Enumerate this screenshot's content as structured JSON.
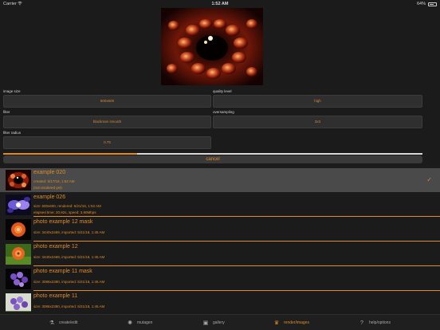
{
  "status": {
    "carrier": "Carrier",
    "time": "1:52 AM",
    "battery": "64%"
  },
  "settings": {
    "image_size": {
      "label": "image size",
      "value": "600x600"
    },
    "quality_level": {
      "label": "quality level",
      "value": "high"
    },
    "filter": {
      "label": "filter",
      "value": "blackman smooth"
    },
    "oversampling": {
      "label": "oversampling",
      "value": "3x3"
    },
    "filter_radius": {
      "label": "filter radius",
      "value": "0.75"
    }
  },
  "render": {
    "progress": 0.32,
    "cancel_label": "cancel"
  },
  "items": [
    {
      "title": "example 020",
      "line1": "created: 5/17/18, 1:52 AM",
      "line2": "(not rendered yet)",
      "selected": true
    },
    {
      "title": "example 026",
      "line1": "size: 600x600, rendered: 5/21/18, 1:52 AM",
      "line2": "elapsed time: 20.82s, speed: 3.80Mbps"
    },
    {
      "title": "photo example 12 mask",
      "line1": "size: 3440x2469, imported: 5/21/18, 1:45 AM"
    },
    {
      "title": "photo example 12",
      "line1": "size: 3440x2469, imported: 5/21/18, 1:45 AM"
    },
    {
      "title": "photo example 11 mask",
      "line1": "size: 3086x2380, imported: 5/21/18, 1:45 AM"
    },
    {
      "title": "photo example 11",
      "line1": "size: 3086x2380, imported: 5/21/18, 1:45 AM"
    }
  ],
  "tabs": [
    {
      "label": "create/edit",
      "icon": "flask-icon"
    },
    {
      "label": "mutagen",
      "icon": "mutagen-icon"
    },
    {
      "label": "gallery",
      "icon": "gallery-icon"
    },
    {
      "label": "render/images",
      "icon": "render-icon",
      "active": true
    },
    {
      "label": "help/options",
      "icon": "help-icon"
    }
  ],
  "colors": {
    "accent": "#e08a28",
    "background": "#1b1b1b",
    "field": "#2f2f2f",
    "selected_row": "#4a4a4a"
  }
}
